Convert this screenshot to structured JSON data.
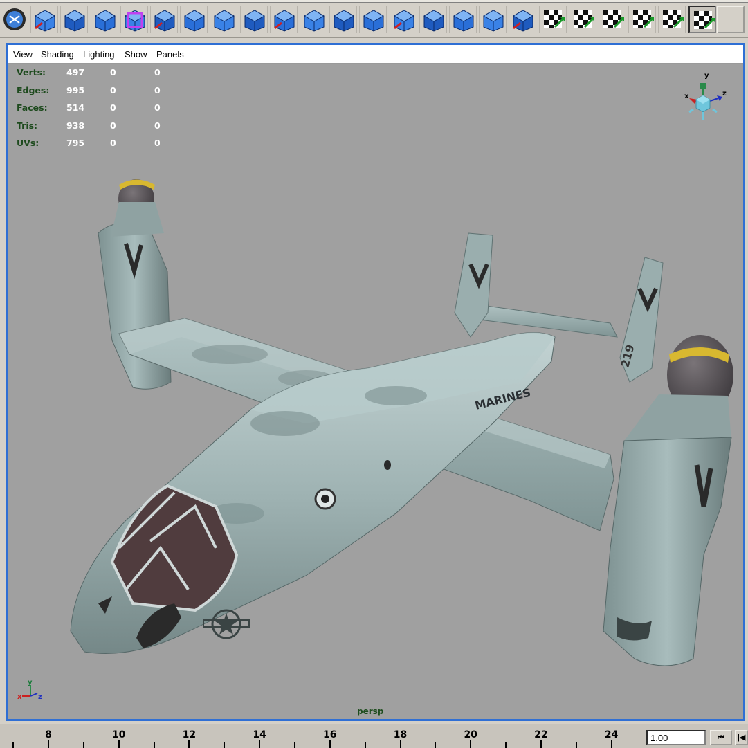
{
  "toolbar": {
    "icons": [
      "select-mode-icon",
      "component-mode-icon",
      "uv-sphere-icon",
      "poly-sphere-icon",
      "bounding-box-icon",
      "extrude-face-icon",
      "split-polygon-icon",
      "bevel-icon",
      "append-polygon-icon",
      "create-polygon-icon",
      "merge-vertices-icon",
      "wedge-face-icon",
      "smooth-icon",
      "collapse-icon",
      "split-edge-icon",
      "poke-face-icon",
      "duplicate-face-icon",
      "move-component-icon",
      "uv-checker-icon",
      "automatic-mapping-icon",
      "cylindrical-mapping-icon",
      "spherical-mapping-icon",
      "uv-texture-editor-icon",
      "uv-layout-icon"
    ]
  },
  "panel": {
    "menu": [
      "View",
      "Shading",
      "Lighting",
      "Show",
      "Panels"
    ],
    "camera_label": "persp"
  },
  "hud": {
    "rows": [
      {
        "label": "Verts:",
        "values": [
          "497",
          "0",
          "0"
        ]
      },
      {
        "label": "Edges:",
        "values": [
          "995",
          "0",
          "0"
        ]
      },
      {
        "label": "Faces:",
        "values": [
          "514",
          "0",
          "0"
        ]
      },
      {
        "label": "Tris:",
        "values": [
          "938",
          "0",
          "0"
        ]
      },
      {
        "label": "UVs:",
        "values": [
          "795",
          "0",
          "0"
        ]
      }
    ]
  },
  "model": {
    "fuselage_text": "MARINES",
    "tail_number": "219"
  },
  "view_axes": {
    "x": "x",
    "y": "y",
    "z": "z"
  },
  "timeline": {
    "ticks": [
      "8",
      "10",
      "12",
      "14",
      "16",
      "18",
      "20",
      "22",
      "24"
    ],
    "current_time": "1.00",
    "rewind_label": "⏮",
    "step_back_label": "|◀"
  },
  "colors": {
    "viewport_bg": "#a0a0a0",
    "active_panel_border": "#2f6fd4",
    "hud_label": "#1d4a1d",
    "hud_value": "#ffffff",
    "aircraft_body": "#a9bcbc",
    "nacelle_cap_ring": "#d8b830"
  }
}
